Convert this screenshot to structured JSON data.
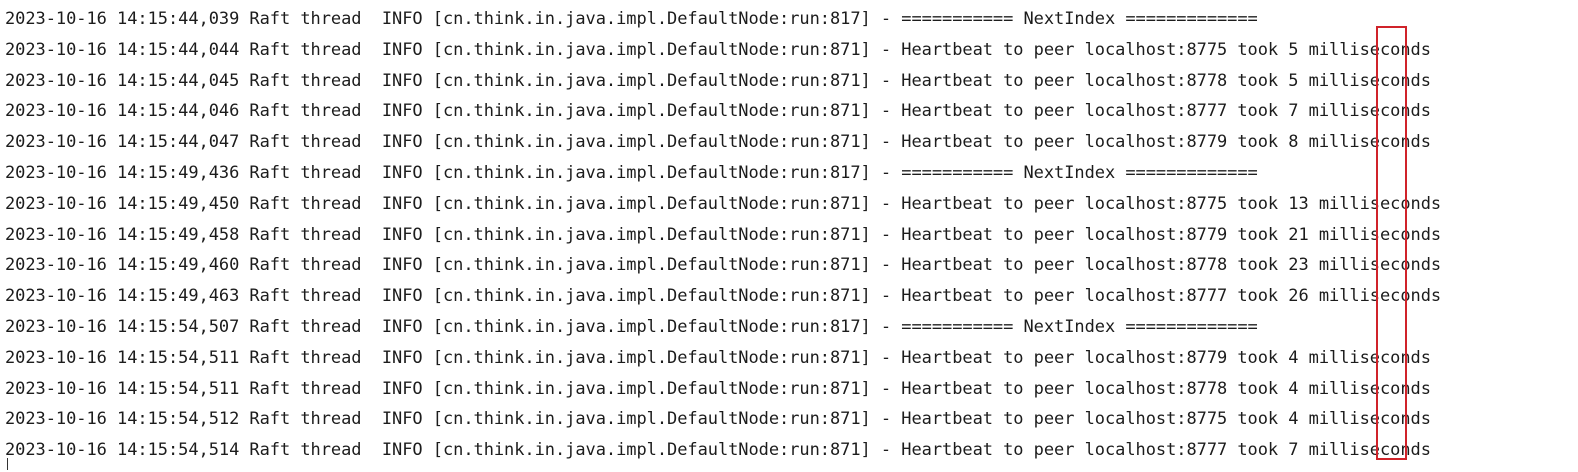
{
  "console": {
    "lines": [
      "2023-10-16 14:15:44,039 Raft thread  INFO [cn.think.in.java.impl.DefaultNode:run:817] - =========== NextIndex =============",
      "2023-10-16 14:15:44,044 Raft thread  INFO [cn.think.in.java.impl.DefaultNode:run:871] - Heartbeat to peer localhost:8775 took 5 milliseconds",
      "2023-10-16 14:15:44,045 Raft thread  INFO [cn.think.in.java.impl.DefaultNode:run:871] - Heartbeat to peer localhost:8778 took 5 milliseconds",
      "2023-10-16 14:15:44,046 Raft thread  INFO [cn.think.in.java.impl.DefaultNode:run:871] - Heartbeat to peer localhost:8777 took 7 milliseconds",
      "2023-10-16 14:15:44,047 Raft thread  INFO [cn.think.in.java.impl.DefaultNode:run:871] - Heartbeat to peer localhost:8779 took 8 milliseconds",
      "2023-10-16 14:15:49,436 Raft thread  INFO [cn.think.in.java.impl.DefaultNode:run:817] - =========== NextIndex =============",
      "2023-10-16 14:15:49,450 Raft thread  INFO [cn.think.in.java.impl.DefaultNode:run:871] - Heartbeat to peer localhost:8775 took 13 milliseconds",
      "2023-10-16 14:15:49,458 Raft thread  INFO [cn.think.in.java.impl.DefaultNode:run:871] - Heartbeat to peer localhost:8779 took 21 milliseconds",
      "2023-10-16 14:15:49,460 Raft thread  INFO [cn.think.in.java.impl.DefaultNode:run:871] - Heartbeat to peer localhost:8778 took 23 milliseconds",
      "2023-10-16 14:15:49,463 Raft thread  INFO [cn.think.in.java.impl.DefaultNode:run:871] - Heartbeat to peer localhost:8777 took 26 milliseconds",
      "2023-10-16 14:15:54,507 Raft thread  INFO [cn.think.in.java.impl.DefaultNode:run:817] - =========== NextIndex =============",
      "2023-10-16 14:15:54,511 Raft thread  INFO [cn.think.in.java.impl.DefaultNode:run:871] - Heartbeat to peer localhost:8779 took 4 milliseconds",
      "2023-10-16 14:15:54,511 Raft thread  INFO [cn.think.in.java.impl.DefaultNode:run:871] - Heartbeat to peer localhost:8778 took 4 milliseconds",
      "2023-10-16 14:15:54,512 Raft thread  INFO [cn.think.in.java.impl.DefaultNode:run:871] - Heartbeat to peer localhost:8775 took 4 milliseconds",
      "2023-10-16 14:15:54,514 Raft thread  INFO [cn.think.in.java.impl.DefaultNode:run:871] - Heartbeat to peer localhost:8777 took 7 milliseconds"
    ]
  },
  "annotation": {
    "highlight_color": "#d0232a"
  },
  "colors": {
    "background": "#ffffff",
    "text": "#1c1c1c"
  }
}
